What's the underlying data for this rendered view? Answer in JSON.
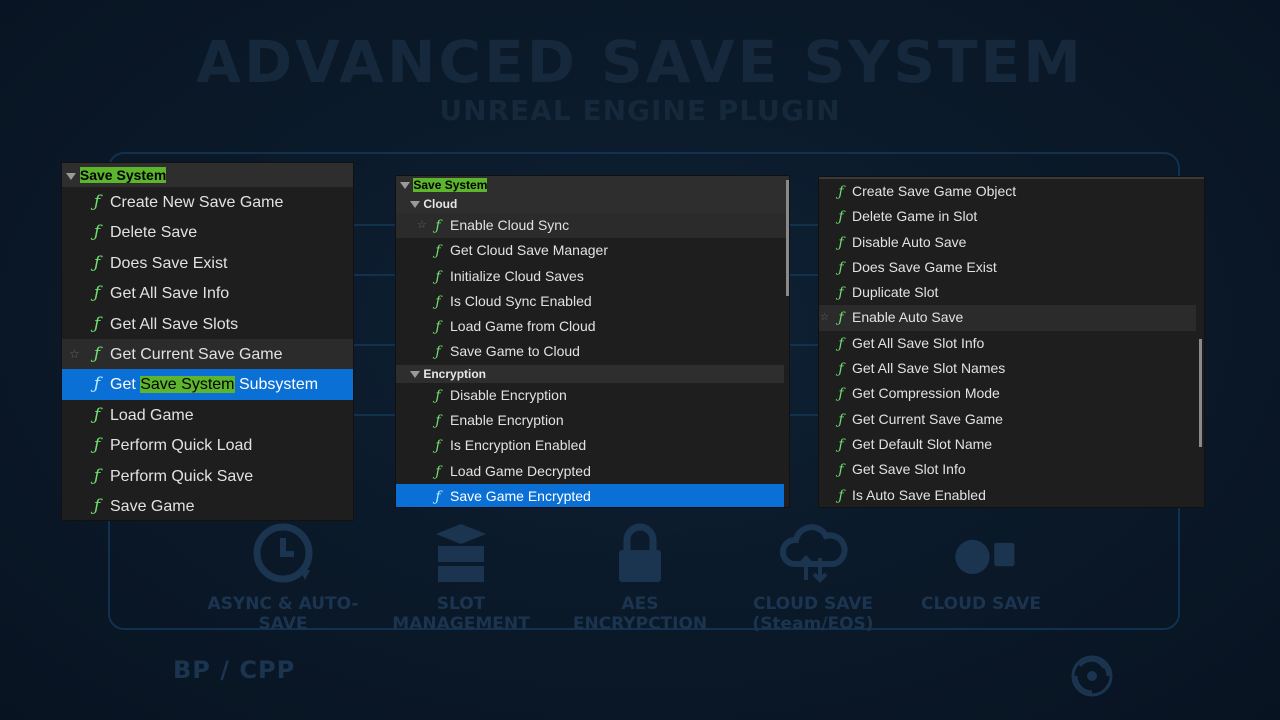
{
  "banner": {
    "title": "ADVANCED SAVE SYSTEM",
    "subtitle": "UNREAL ENGINE PLUGIN"
  },
  "features": [
    {
      "label": "ASYNC & AUTO-SAVE",
      "icon": "clock-arrow-icon"
    },
    {
      "label": "SLOT MANAGEMENT",
      "icon": "stack-boxes-icon"
    },
    {
      "label": "AES ENCRYPCTION",
      "icon": "padlock-icon"
    },
    {
      "label": "CLOUD SAVE\n(Steam/EOS)",
      "icon": "cloud-upload-icon"
    },
    {
      "label": "CLOUD SAVE",
      "icon": "steam-epic-icon"
    }
  ],
  "footer": {
    "bp_cpp": "BP / CPP",
    "logo_icon": "spiral-logo-icon"
  },
  "panel1": {
    "category": "Save System",
    "items": [
      "Create New Save Game",
      "Delete Save",
      "Does Save Exist",
      "Get All Save Info",
      "Get All Save Slots",
      "Get Current Save Game",
      "Get Save System Subsystem",
      "Load Game",
      "Perform Quick Load",
      "Perform Quick Save",
      "Save Game"
    ],
    "selected_prefix": "Get ",
    "selected_match": "Save System",
    "selected_suffix": " Subsystem"
  },
  "panel2": {
    "category": "Save System",
    "sub1": "Cloud",
    "cloud_items": [
      "Enable Cloud Sync",
      "Get Cloud Save Manager",
      "Initialize Cloud Saves",
      "Is Cloud Sync Enabled",
      "Load Game from Cloud",
      "Save Game to Cloud"
    ],
    "sub2": "Encryption",
    "encryption_items": [
      "Disable Encryption",
      "Enable Encryption",
      "Is Encryption Enabled",
      "Load Game Decrypted",
      "Save Game Encrypted"
    ]
  },
  "panel3": {
    "items": [
      "Create Save Game Object",
      "Delete Game in Slot",
      "Disable Auto Save",
      "Does Save Game Exist",
      "Duplicate Slot",
      "Enable Auto Save",
      "Get All Save Slot Info",
      "Get All Save Slot Names",
      "Get Compression Mode",
      "Get Current Save Game",
      "Get Default Slot Name",
      "Get Save Slot Info",
      "Is Auto Save Enabled"
    ]
  },
  "glyphs": {
    "function": "ƒ",
    "star": "☆"
  },
  "colors": {
    "selection": "#0b70d6",
    "highlight": "#5cb52c",
    "function_icon": "#6ee06e"
  }
}
